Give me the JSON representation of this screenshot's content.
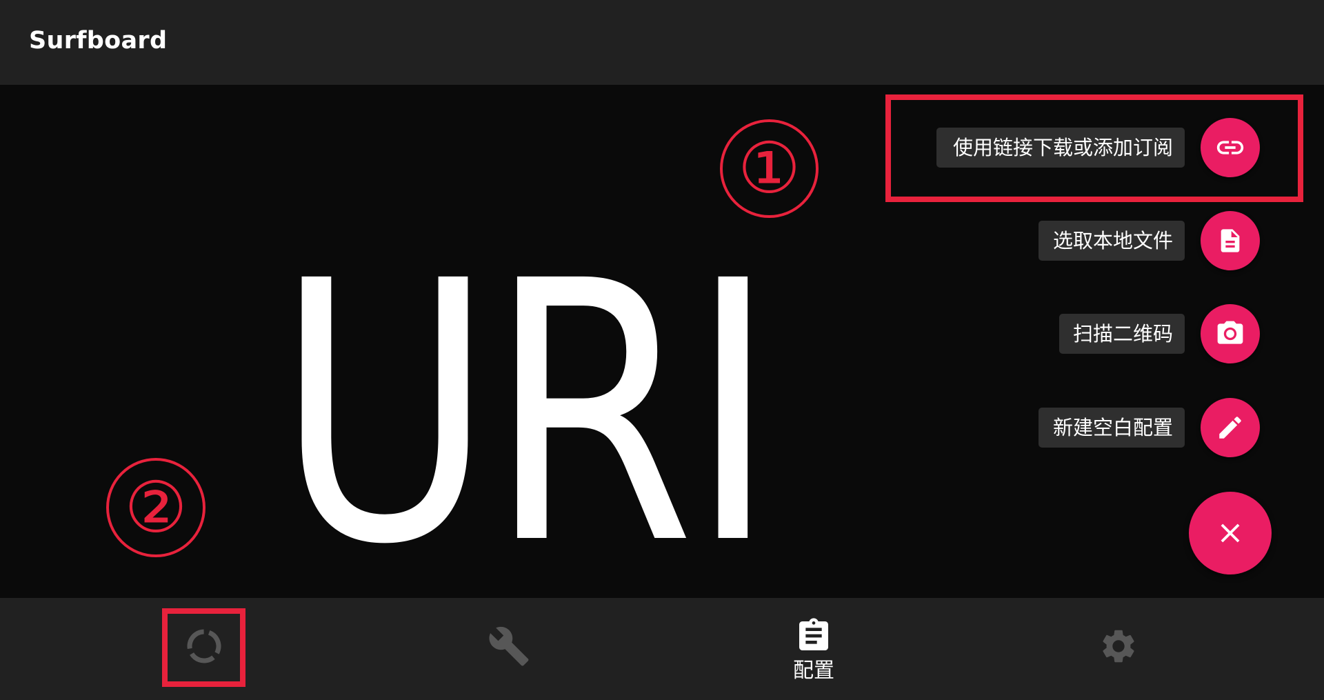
{
  "app": {
    "title": "Surfboard"
  },
  "main": {
    "big_text": "URI"
  },
  "annotations": {
    "circle_1": "①",
    "circle_2": "②"
  },
  "speed_dial": {
    "items": [
      {
        "label": "使用链接下载或添加订阅",
        "icon": "link-icon"
      },
      {
        "label": "选取本地文件",
        "icon": "file-icon"
      },
      {
        "label": "扫描二维码",
        "icon": "camera-icon"
      },
      {
        "label": "新建空白配置",
        "icon": "pencil-icon"
      }
    ],
    "close_icon": "close-icon"
  },
  "bottom_nav": {
    "items": [
      {
        "id": "status",
        "icon": "status-ring-icon",
        "label": ""
      },
      {
        "id": "tools",
        "icon": "wrench-icon",
        "label": ""
      },
      {
        "id": "config",
        "icon": "clipboard-icon",
        "label": "配置"
      },
      {
        "id": "settings",
        "icon": "gear-icon",
        "label": ""
      }
    ]
  },
  "colors": {
    "accent": "#ea1d63",
    "annotation_red": "#e8223c",
    "appbar_bg": "#212121",
    "content_bg": "#0a0a0a",
    "inactive_icon": "#575757",
    "active_icon": "#ffffff"
  }
}
